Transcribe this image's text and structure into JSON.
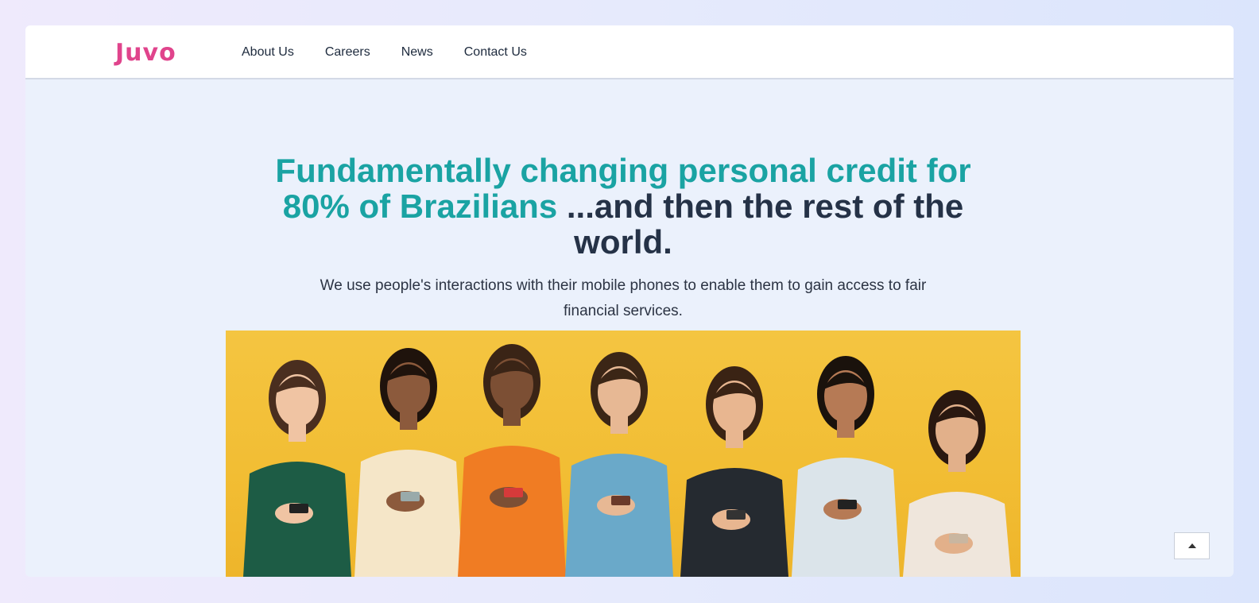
{
  "brand": {
    "logo_text": "Juvo",
    "logo_color": "#e0448c"
  },
  "nav": {
    "items": [
      {
        "label": "About Us"
      },
      {
        "label": "Careers"
      },
      {
        "label": "News"
      },
      {
        "label": "Contact Us"
      }
    ]
  },
  "hero": {
    "title_accent": "Fundamentally changing personal credit for 80% of Brazilians",
    "title_rest": " ...and then the rest of the world.",
    "subtitle": "We use people's interactions with their mobile phones to enable them to gain access to fair financial services.",
    "accent_color": "#1aa3a3",
    "text_color": "#253247"
  },
  "image": {
    "background_color": "#f2bd33",
    "people": [
      {
        "hair": "#4a2e1f",
        "skin": "#f0c4a3",
        "top": "#1d5c45",
        "phone": "#222"
      },
      {
        "hair": "#1f130c",
        "skin": "#8c5a3c",
        "top": "#f5e6c8",
        "phone": "#9aa"
      },
      {
        "hair": "#3a2416",
        "skin": "#7c4f34",
        "top": "#f07c23",
        "phone": "#d63a3a"
      },
      {
        "hair": "#3b2616",
        "skin": "#e7b894",
        "top": "#6aa9c9",
        "phone": "#6a3a2a"
      },
      {
        "hair": "#3a2314",
        "skin": "#e8b690",
        "top": "#252a30",
        "phone": "#333"
      },
      {
        "hair": "#1a120c",
        "skin": "#b67a55",
        "top": "#dbe4ea",
        "phone": "#222"
      },
      {
        "hair": "#2a1810",
        "skin": "#e2b08a",
        "top": "#efe6dc",
        "phone": "#c9b6a0"
      }
    ]
  },
  "scroll_top": {
    "icon": "caret-up-icon"
  }
}
